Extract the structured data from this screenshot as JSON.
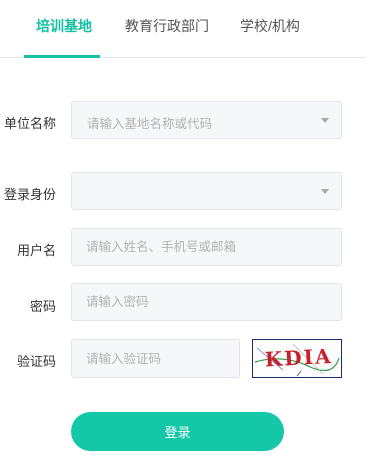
{
  "tabs": [
    {
      "label": "培训基地",
      "active": true
    },
    {
      "label": "教育行政部门",
      "active": false
    },
    {
      "label": "学校/机构",
      "active": false
    }
  ],
  "form": {
    "unit": {
      "label": "单位名称",
      "placeholder": "请输入基地名称或代码"
    },
    "identity": {
      "label": "登录身份",
      "value": ""
    },
    "username": {
      "label": "用户名",
      "placeholder": "请输入姓名、手机号或邮箱"
    },
    "password": {
      "label": "密码",
      "placeholder": "请输入密码"
    },
    "captcha": {
      "label": "验证码",
      "placeholder": "请输入验证码",
      "image_text": "KDIA"
    }
  },
  "login_label": "登录",
  "colors": {
    "accent": "#14c1a3",
    "button": "#14c7a6"
  }
}
